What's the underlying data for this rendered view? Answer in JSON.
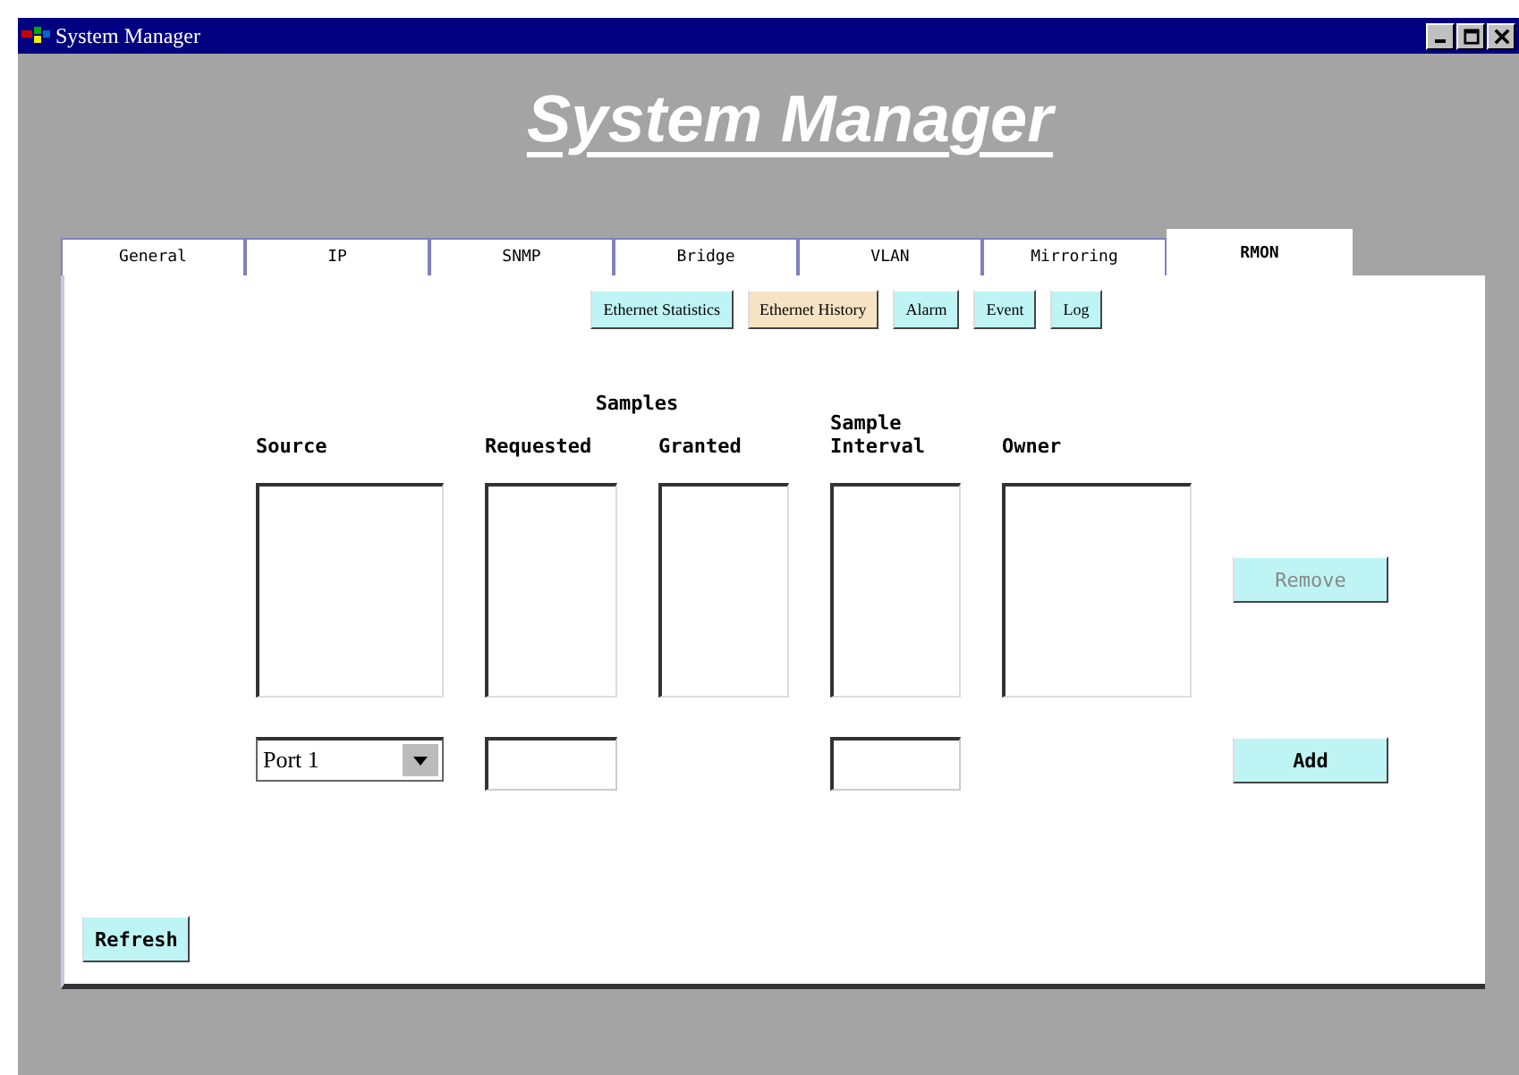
{
  "window": {
    "title": "System Manager"
  },
  "heading": "System Manager",
  "tabs": [
    {
      "label": "General",
      "selected": false
    },
    {
      "label": "IP",
      "selected": false
    },
    {
      "label": "SNMP",
      "selected": false
    },
    {
      "label": "Bridge",
      "selected": false
    },
    {
      "label": "VLAN",
      "selected": false
    },
    {
      "label": "Mirroring",
      "selected": false
    },
    {
      "label": "RMON",
      "selected": true
    }
  ],
  "subtabs": [
    {
      "label": "Ethernet Statistics",
      "selected": false
    },
    {
      "label": "Ethernet History",
      "selected": true
    },
    {
      "label": "Alarm",
      "selected": false
    },
    {
      "label": "Event",
      "selected": false
    },
    {
      "label": "Log",
      "selected": false
    }
  ],
  "headers": {
    "source": "Source",
    "samples": "Samples",
    "requested": "Requested",
    "granted": "Granted",
    "interval": "Sample Interval",
    "owner": "Owner"
  },
  "source_select": {
    "value": "Port 1"
  },
  "buttons": [
    {
      "label": "Remove",
      "disabled": true
    },
    {
      "label": "Add",
      "disabled": false
    },
    {
      "label": "Refresh",
      "disabled": false
    }
  ]
}
